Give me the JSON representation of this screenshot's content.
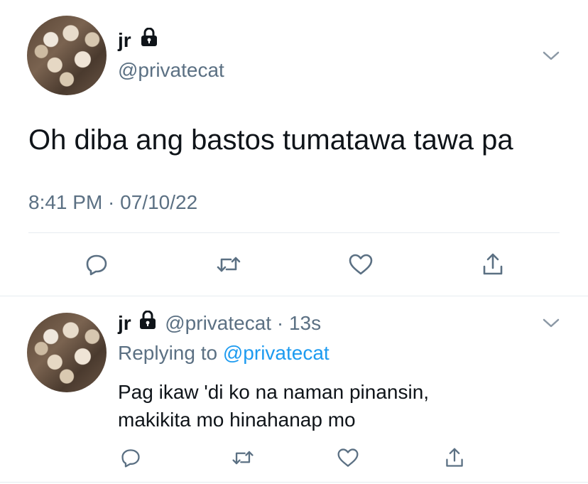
{
  "main_tweet": {
    "name": "jr",
    "handle": "@privatecat",
    "text": "Oh diba ang bastos tumatawa tawa pa",
    "timestamp": "8:41 PM · 07/10/22",
    "icons": [
      "lock-icon",
      "chevron-down-icon",
      "reply-icon",
      "retweet-icon",
      "like-icon",
      "share-icon"
    ]
  },
  "reply_tweet": {
    "name": "jr",
    "handle": "@privatecat",
    "separator": "·",
    "time": "13s",
    "replying_prefix": "Replying to",
    "replying_handle": "@privatecat",
    "text_line1": "Pag ikaw 'di ko na naman pinansin,",
    "text_line2": "makikita mo hinahanap mo",
    "icons": [
      "lock-icon",
      "chevron-down-icon",
      "reply-icon",
      "retweet-icon",
      "like-icon",
      "share-icon"
    ]
  },
  "colors": {
    "text": "#0f1419",
    "secondary": "#5b7083",
    "link": "#1d9bf0",
    "divider": "#e6ecf0"
  }
}
